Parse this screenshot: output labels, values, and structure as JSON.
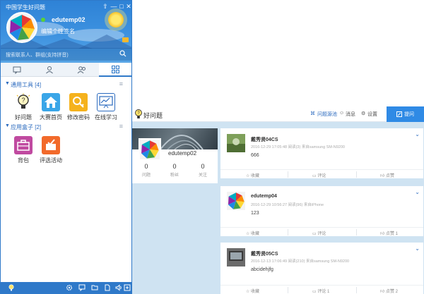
{
  "im": {
    "title": "中国学生好问题",
    "window_buttons": [
      "⇧",
      "—",
      "□",
      "✕"
    ],
    "user": {
      "name": "edutemp02",
      "signature": "编辑个性签名"
    },
    "search": {
      "placeholder": "搜索联系人、群组(支持拼音)"
    },
    "tabs": [
      "chat-icon",
      "contact-icon",
      "group-icon",
      "apps-icon"
    ],
    "groups": [
      {
        "label": "通用工具 [4]",
        "apps": [
          "好问题",
          "大赛首页",
          "修改密码",
          "在线学习"
        ]
      },
      {
        "label": "应用盒子 [2]",
        "apps": [
          "背包",
          "评选活动"
        ]
      }
    ],
    "bottom_icons": [
      "logo-icon",
      "gear-icon",
      "message-icon",
      "folder-icon",
      "file-icon",
      "speaker-icon",
      "add-icon"
    ]
  },
  "web": {
    "logo_text": "好问题",
    "nav": {
      "square": "问题源池",
      "message": "消息",
      "settings": "设置",
      "publish": "提问"
    },
    "profile": {
      "name": "edutemp02",
      "stats": [
        {
          "num": "0",
          "label": "问题"
        },
        {
          "num": "0",
          "label": "粉丝"
        },
        {
          "num": "0",
          "label": "关注"
        }
      ]
    },
    "posts": [
      {
        "name": "戴秀贤04CS",
        "meta": "2016-12-29 17:05:48   阅读(3)   来自samsung SM-N9200",
        "body": "666",
        "collect": "收藏",
        "comment": "评论",
        "like": "点赞"
      },
      {
        "name": "edutemp04",
        "meta": "2016-12-29 10:56:27   阅读(96)   来自iPhone",
        "body": "123",
        "collect": "收藏",
        "comment": "评论",
        "like": "点赞 1"
      },
      {
        "name": "戴秀贤05CS",
        "meta": "2016-12-13 17:06:49   阅读(210)   来自samsung SM-N9200",
        "body": "abcidehjfg",
        "collect": "收藏",
        "comment": "评论 1",
        "like": "点赞 2"
      }
    ]
  },
  "colors": {
    "primary": "#2f79c9",
    "publish": "#2f8ae5",
    "online": "#5bd236"
  }
}
